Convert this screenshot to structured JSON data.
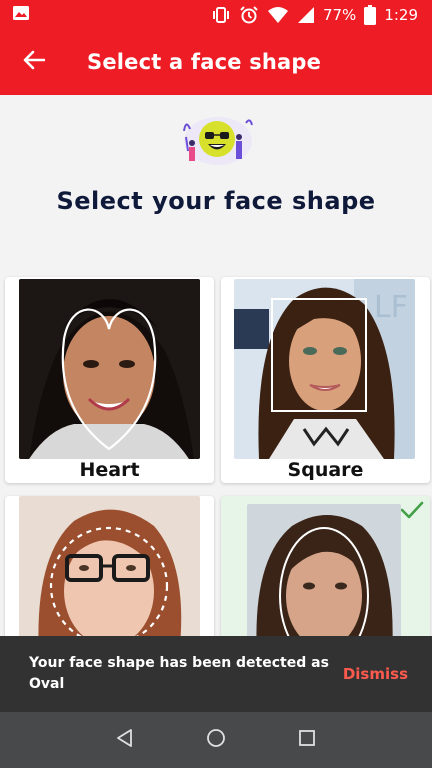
{
  "status_bar": {
    "battery": "77%",
    "time": "1:29",
    "icons": [
      "image-icon",
      "vibrate-icon",
      "alarm-icon",
      "wifi-icon",
      "signal-icon",
      "battery-icon"
    ]
  },
  "app_bar": {
    "title": "Select a face shape",
    "back_icon": "arrow-back-icon"
  },
  "main": {
    "heading": "Select your face shape",
    "cards": [
      {
        "label": "Heart",
        "selected": false
      },
      {
        "label": "Square",
        "selected": false
      },
      {
        "label": "",
        "selected": false
      },
      {
        "label": "",
        "selected": true
      }
    ]
  },
  "snackbar": {
    "message": "Your face shape has been detected as Oval",
    "action": "Dismiss"
  },
  "colors": {
    "brand_red": "#ee1c25",
    "heading_navy": "#0f1a3b",
    "snackbar_bg": "#323232",
    "snackbar_action": "#ff5a4e",
    "check_green": "#43a047",
    "selected_bg": "#e6f5e8",
    "navbar_bg": "#48494b"
  },
  "nav_bar": {
    "icons": [
      "back-triangle-icon",
      "home-circle-icon",
      "recents-square-icon"
    ]
  }
}
